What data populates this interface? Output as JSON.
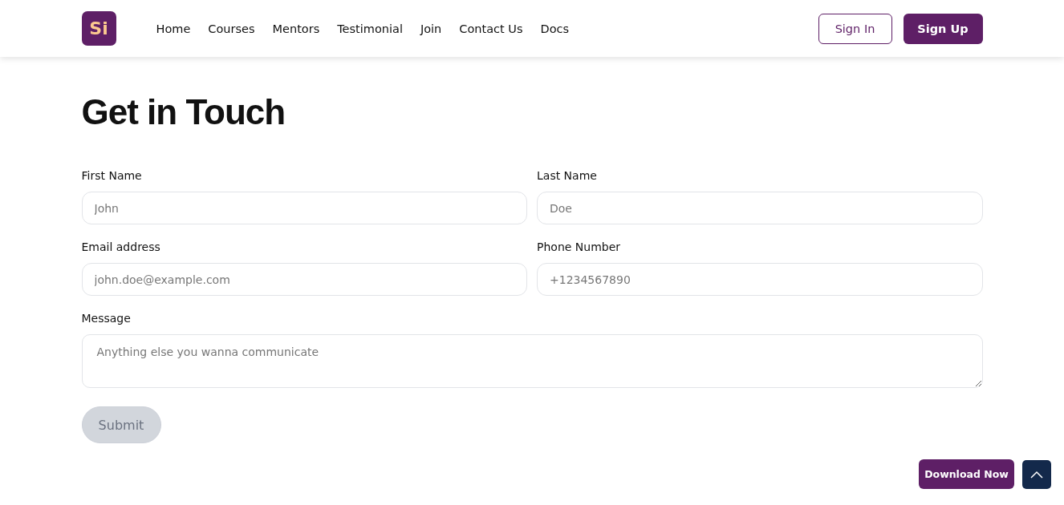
{
  "header": {
    "logo": "Si",
    "nav": [
      {
        "label": "Home"
      },
      {
        "label": "Courses"
      },
      {
        "label": "Mentors"
      },
      {
        "label": "Testimonial"
      },
      {
        "label": "Join"
      },
      {
        "label": "Contact Us"
      },
      {
        "label": "Docs"
      }
    ],
    "sign_in": "Sign In",
    "sign_up": "Sign Up"
  },
  "form": {
    "title": "Get in Touch",
    "fields": [
      {
        "label": "First Name",
        "placeholder": "John"
      },
      {
        "label": "Last Name",
        "placeholder": "Doe"
      },
      {
        "label": "Email address",
        "placeholder": "john.doe@example.com"
      },
      {
        "label": "Phone Number",
        "placeholder": "+1234567890"
      }
    ],
    "message": {
      "label": "Message",
      "placeholder": "Anything else you wanna communicate"
    },
    "submit": {
      "label": "Submit",
      "disabled": true
    }
  },
  "download_button": "Download Now"
}
